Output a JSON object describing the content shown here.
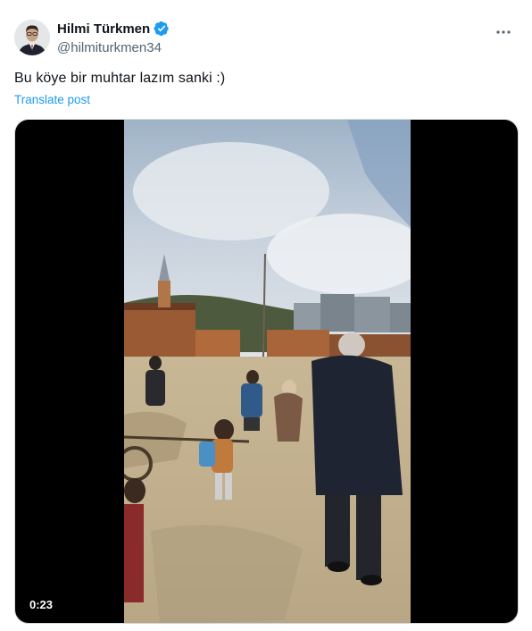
{
  "author": {
    "name": "Hilmi Türkmen",
    "handle": "@hilmiturkmen34",
    "verified": true,
    "avatar_icon": "profile-photo"
  },
  "post": {
    "text": "Bu köye bir muhtar lazım sanki :)",
    "translate_label": "Translate post"
  },
  "video": {
    "duration": "0:23"
  },
  "colors": {
    "link": "#1d9bf0",
    "secondary_text": "#536471",
    "primary_text": "#0f1419"
  }
}
